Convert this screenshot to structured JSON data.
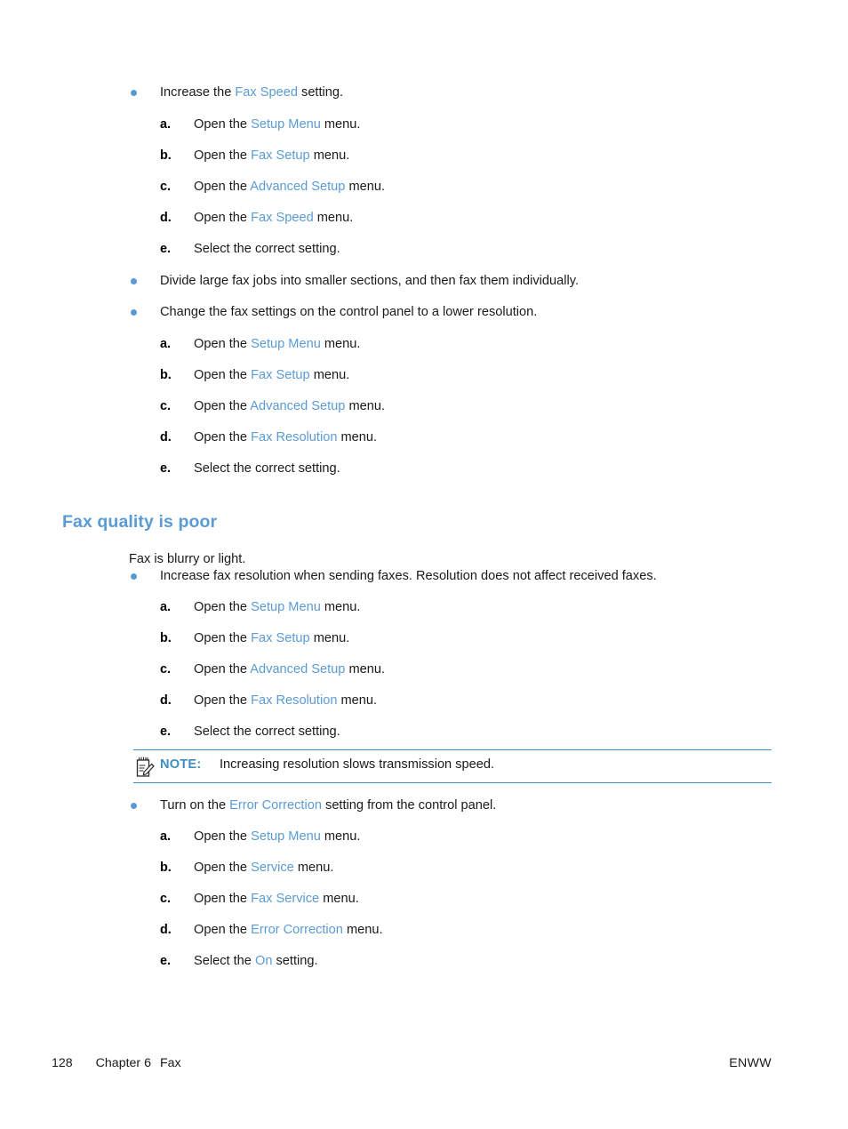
{
  "colors": {
    "ui_blue": "#5b9bd5",
    "heading_blue": "#5b9bd5",
    "note_blue": "#3f8fc0",
    "bullet_blue": "#589ad4",
    "body_text": "#1a1a1a"
  },
  "blocks": {
    "bullet_fax_speed": {
      "text_before": "Increase the ",
      "ui_term": "Fax Speed",
      "text_after": " setting."
    },
    "steps_fax_speed": [
      {
        "marker": "a.",
        "before": "Open the ",
        "ui": "Setup Menu",
        "after": " menu."
      },
      {
        "marker": "b.",
        "before": "Open the ",
        "ui": "Fax Setup",
        "after": " menu."
      },
      {
        "marker": "c.",
        "before": "Open the ",
        "ui": "Advanced Setup",
        "after": " menu."
      },
      {
        "marker": "d.",
        "before": "Open the ",
        "ui": "Fax Speed",
        "after": " menu."
      },
      {
        "marker": "e.",
        "before": "Select the correct setting.",
        "ui": "",
        "after": ""
      }
    ],
    "bullet_divide": {
      "text_before": "Divide large fax jobs into smaller sections, and then fax them individually.",
      "ui_term": "",
      "text_after": ""
    },
    "bullet_lower_resolution": {
      "text_before": "Change the fax settings on the control panel to a lower resolution.",
      "ui_term": "",
      "text_after": ""
    },
    "steps_lower_resolution": [
      {
        "marker": "a.",
        "before": "Open the ",
        "ui": "Setup Menu",
        "after": " menu."
      },
      {
        "marker": "b.",
        "before": "Open the ",
        "ui": "Fax Setup",
        "after": " menu."
      },
      {
        "marker": "c.",
        "before": "Open the ",
        "ui": "Advanced Setup",
        "after": " menu."
      },
      {
        "marker": "d.",
        "before": "Open the ",
        "ui": "Fax Resolution",
        "after": " menu."
      },
      {
        "marker": "e.",
        "before": "Select the correct setting.",
        "ui": "",
        "after": ""
      }
    ],
    "heading": "Fax quality is poor",
    "intro_paragraph": "Fax is blurry or light.",
    "bullet_increase_resolution": {
      "text_before": "Increase fax resolution when sending faxes. Resolution does not affect received faxes.",
      "ui_term": "",
      "text_after": ""
    },
    "steps_increase_resolution": [
      {
        "marker": "a.",
        "before": "Open the ",
        "ui": "Setup Menu",
        "after": " menu."
      },
      {
        "marker": "b.",
        "before": "Open the ",
        "ui": "Fax Setup",
        "after": " menu."
      },
      {
        "marker": "c.",
        "before": "Open the ",
        "ui": "Advanced Setup",
        "after": " menu."
      },
      {
        "marker": "d.",
        "before": "Open the ",
        "ui": "Fax Resolution",
        "after": " menu."
      },
      {
        "marker": "e.",
        "before": "Select the correct setting.",
        "ui": "",
        "after": ""
      }
    ],
    "note": {
      "icon": "notepad-pencil-icon",
      "label": "NOTE:",
      "text": "Increasing resolution slows transmission speed."
    },
    "bullet_error_correction": {
      "text_before": "Turn on the ",
      "ui_term": "Error Correction",
      "text_after": " setting from the control panel."
    },
    "steps_error_correction": [
      {
        "marker": "a.",
        "before": "Open the ",
        "ui": "Setup Menu",
        "after": " menu."
      },
      {
        "marker": "b.",
        "before": "Open the ",
        "ui": "Service",
        "after": " menu."
      },
      {
        "marker": "c.",
        "before": "Open the ",
        "ui": "Fax Service",
        "after": " menu."
      },
      {
        "marker": "d.",
        "before": "Open the ",
        "ui": "Error Correction",
        "after": " menu."
      },
      {
        "marker": "e.",
        "before": "Select the ",
        "ui": "On",
        "after": " setting."
      }
    ]
  },
  "footer": {
    "page_number": "128",
    "chapter": "Chapter 6",
    "chapter_title": "Fax",
    "locale": "ENWW"
  }
}
